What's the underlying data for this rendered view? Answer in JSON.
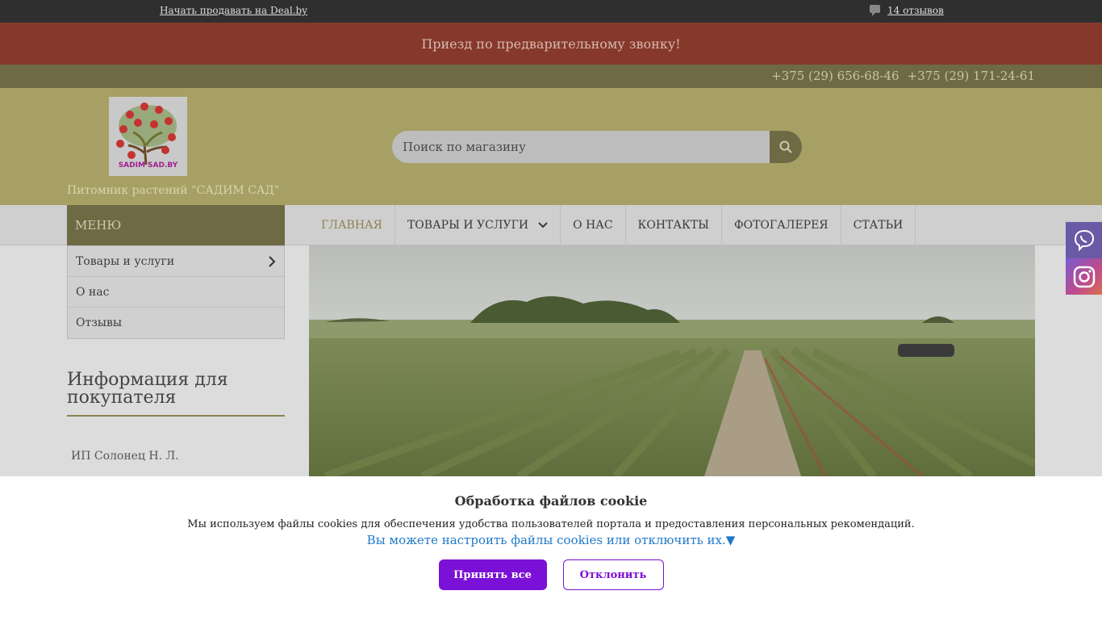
{
  "topbar": {
    "sell_link": "Начать продавать на Deal.by",
    "reviews_link": "14 отзывов"
  },
  "announcement": "Приезд по предварительному звонку!",
  "phones": [
    "+375 (29) 656-68-46",
    "+375 (29) 171-24-61"
  ],
  "header": {
    "logo_text": "SADIM SAD.BY",
    "store_name": "Питомник растений \"САДИМ САД\"",
    "search_placeholder": "Поиск по магазину"
  },
  "menu": {
    "label": "МЕНЮ",
    "items": [
      {
        "label": "Товары и услуги",
        "has_submenu": true
      },
      {
        "label": "О нас",
        "has_submenu": false
      },
      {
        "label": "Отзывы",
        "has_submenu": false
      }
    ]
  },
  "nav": {
    "items": [
      {
        "label": "ГЛАВНАЯ",
        "active": true
      },
      {
        "label": "ТОВАРЫ И УСЛУГИ",
        "dropdown": true
      },
      {
        "label": "О НАС"
      },
      {
        "label": "КОНТАКТЫ"
      },
      {
        "label": "ФОТОГАЛЕРЕЯ"
      },
      {
        "label": "СТАТЬИ"
      }
    ]
  },
  "sidebar": {
    "info_title": "Информация для покупателя",
    "company": "ИП Солонец Н. Л."
  },
  "social": {
    "icons": [
      "viber-icon",
      "instagram-icon"
    ]
  },
  "cookie": {
    "title": "Обработка файлов cookie",
    "text": "Мы используем файлы cookies для обеспечения удобства пользователей портала и предоставления персональных рекомендаций.",
    "settings_link": "Вы можете настроить файлы cookies или отключить их.▼",
    "accept": "Принять все",
    "decline": "Отклонить"
  },
  "colors": {
    "topbar": "#2f2f2f",
    "announcement": "#86392b",
    "header": "#a7a064",
    "accent": "#6e6a44",
    "cookie_button": "#7b10d6",
    "cookie_link": "#1f79c8"
  }
}
